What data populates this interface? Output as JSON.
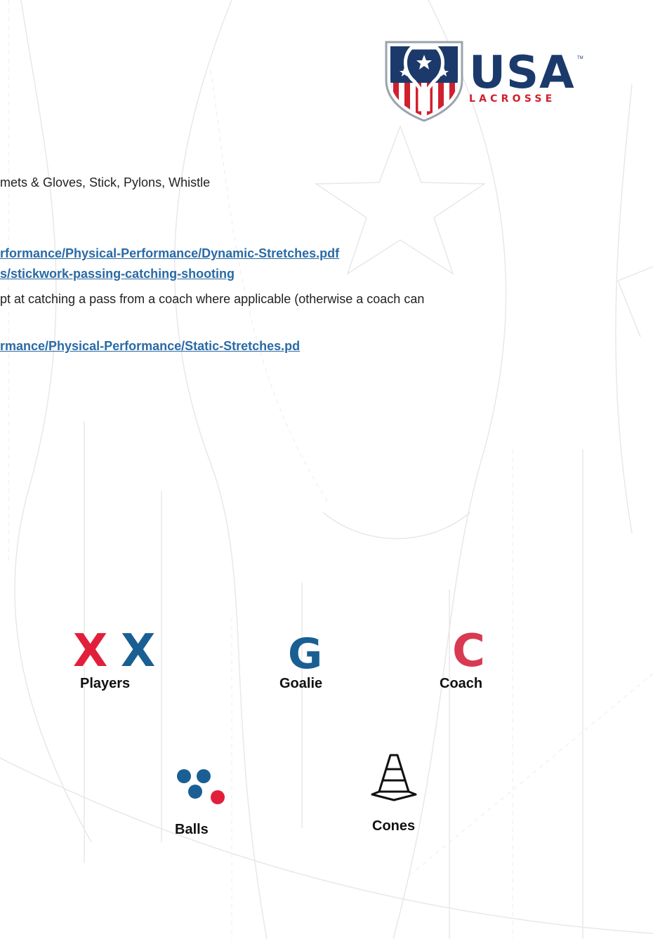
{
  "logo": {
    "wordmark": "USA",
    "subtitle": "LACROSSE",
    "trademark": "TM",
    "colors": {
      "navy": "#1b3a6b",
      "red": "#d0202e"
    }
  },
  "content": {
    "equipment_line": "mets & Gloves, Stick, Pylons, Whistle",
    "link_dynamic": "rformance/Physical-Performance/Dynamic-Stretches.pdf",
    "link_stickwork": "s/stickwork-passing-catching-shooting",
    "drill_line": "pt at catching a pass from a coach where applicable (otherwise a coach can",
    "link_static": "rmance/Physical-Performance/Static-Stretches.pd"
  },
  "legend": {
    "players": {
      "glyph_red": "X",
      "glyph_blue": "X",
      "label": "Players"
    },
    "goalie": {
      "glyph": "G",
      "label": "Goalie"
    },
    "coach": {
      "glyph": "C",
      "label": "Coach"
    },
    "balls": {
      "label": "Balls"
    },
    "cones": {
      "label": "Cones"
    }
  },
  "colors": {
    "red": "#e21f3b",
    "blue": "#1a5f94",
    "coach_red": "#d83a52",
    "link": "#2a6aa5"
  }
}
